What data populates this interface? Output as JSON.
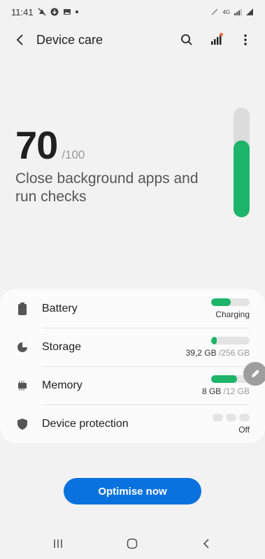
{
  "status_bar": {
    "time": "11:41",
    "left_icons": [
      "notification-off-icon",
      "download-icon",
      "image-icon"
    ],
    "network_label": "4G",
    "right_icons": [
      "pen-icon",
      "network-arrows-icon",
      "signal-icon",
      "signal-icon"
    ]
  },
  "header": {
    "title": "Device care",
    "back_icon": "chevron-left-icon",
    "search_icon": "search-icon",
    "diagnostics_icon": "signal-bars-icon",
    "more_icon": "more-vert-icon"
  },
  "score": {
    "value": "70",
    "max": "/100",
    "fraction": 0.7,
    "message": "Close background apps and run checks"
  },
  "colors": {
    "accent_green": "#1db56a",
    "button_blue": "#0a72de",
    "badge_orange": "#f06a3a"
  },
  "items": [
    {
      "label": "Battery",
      "icon": "battery-icon",
      "status": "Charging",
      "fill": 0.5
    },
    {
      "label": "Storage",
      "icon": "storage-pie-icon",
      "used": "39,2 GB",
      "total": "/256 GB",
      "fill": 0.15
    },
    {
      "label": "Memory",
      "icon": "memory-chip-icon",
      "used": "8 GB",
      "total": "/12 GB",
      "fill": 0.67
    },
    {
      "label": "Device protection",
      "icon": "shield-icon",
      "status": "Off"
    }
  ],
  "edge_handle_icon": "pencil-icon",
  "optimise_label": "Optimise now",
  "nav": {
    "recent_icon": "recent-apps-icon",
    "home_icon": "home-icon",
    "back_icon": "nav-back-icon"
  }
}
